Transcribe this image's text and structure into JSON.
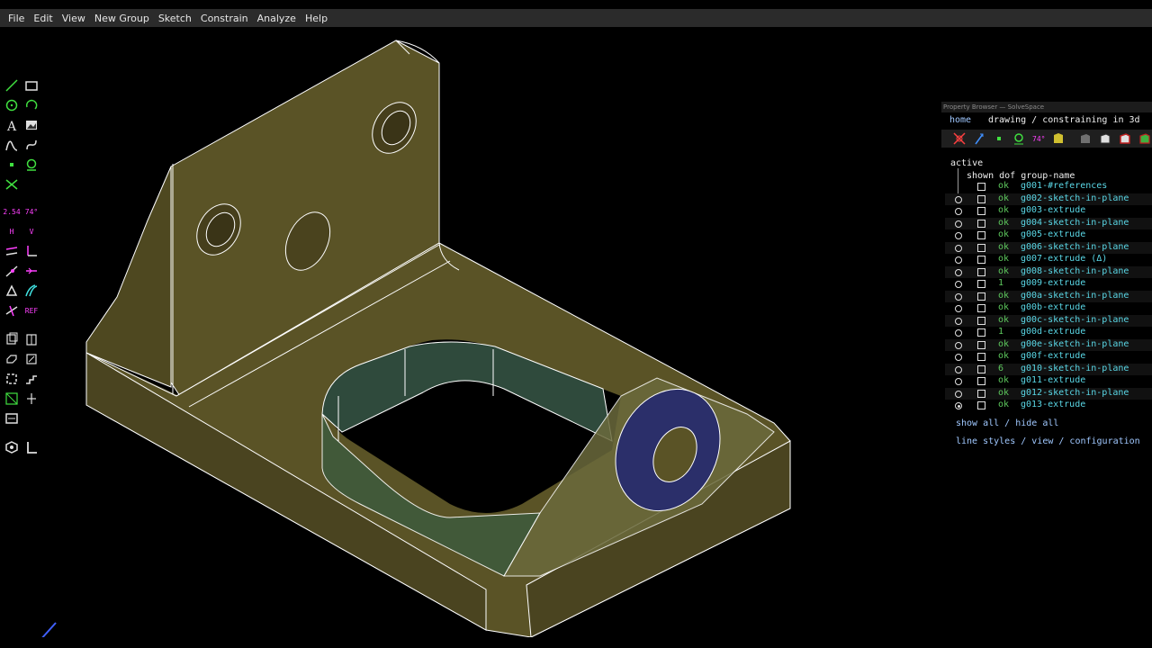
{
  "menu": [
    "File",
    "Edit",
    "View",
    "New Group",
    "Sketch",
    "Constrain",
    "Analyze",
    "Help"
  ],
  "toolbar": {
    "tools": [
      {
        "name": "line-tool-icon"
      },
      {
        "name": "rectangle-tool-icon"
      },
      {
        "name": "circle-tool-icon"
      },
      {
        "name": "arc-tool-icon"
      },
      {
        "name": "text-tool-icon"
      },
      {
        "name": "image-tool-icon"
      },
      {
        "name": "tangent-arc-tool-icon"
      },
      {
        "name": "bezier-tool-icon"
      },
      {
        "name": "point-tool-icon"
      },
      {
        "name": "workplane-tool-icon"
      },
      {
        "name": "split-curves-icon"
      },
      {
        "name": "distance-constraint-icon",
        "label": "2.54"
      },
      {
        "name": "angle-constraint-icon",
        "label": "74°"
      },
      {
        "name": "horizontal-constraint-icon",
        "label": "H"
      },
      {
        "name": "vertical-constraint-icon",
        "label": "V"
      },
      {
        "name": "parallel-constraint-icon"
      },
      {
        "name": "perpendicular-constraint-icon"
      },
      {
        "name": "on-entity-constraint-icon"
      },
      {
        "name": "symmetric-constraint-icon"
      },
      {
        "name": "equal-constraint-icon"
      },
      {
        "name": "tangent-constraint-icon"
      },
      {
        "name": "nearest-ortho-icon"
      },
      {
        "name": "reference-toggle-icon",
        "label": "REF"
      },
      {
        "name": "extrude-group-icon"
      },
      {
        "name": "lathe-group-icon"
      },
      {
        "name": "revolve-group-icon"
      },
      {
        "name": "helix-group-icon"
      },
      {
        "name": "step-rotate-icon"
      },
      {
        "name": "step-translate-icon"
      },
      {
        "name": "in-workplane-icon"
      },
      {
        "name": "in-3d-icon"
      },
      {
        "name": "link-file-icon"
      },
      {
        "name": "nearest-iso-icon"
      },
      {
        "name": "sketch-in-plane-icon"
      }
    ]
  },
  "property_browser": {
    "title": "Property Browser — SolveSpace",
    "home_link": "home",
    "mode": "drawing / constraining in 3d",
    "active_label": "active",
    "columns_header": "shown dof group-name",
    "groups": [
      {
        "radio": false,
        "dof": "ok",
        "name": "g001-#references"
      },
      {
        "radio": true,
        "dof": "ok",
        "name": "g002-sketch-in-plane"
      },
      {
        "radio": true,
        "dof": "ok",
        "name": "g003-extrude"
      },
      {
        "radio": true,
        "dof": "ok",
        "name": "g004-sketch-in-plane"
      },
      {
        "radio": true,
        "dof": "ok",
        "name": "g005-extrude"
      },
      {
        "radio": true,
        "dof": "ok",
        "name": "g006-sketch-in-plane"
      },
      {
        "radio": true,
        "dof": "ok",
        "name": "g007-extrude (Δ)"
      },
      {
        "radio": true,
        "dof": "ok",
        "name": "g008-sketch-in-plane"
      },
      {
        "radio": true,
        "dof": "1",
        "name": "g009-extrude"
      },
      {
        "radio": true,
        "dof": "ok",
        "name": "g00a-sketch-in-plane"
      },
      {
        "radio": true,
        "dof": "ok",
        "name": "g00b-extrude"
      },
      {
        "radio": true,
        "dof": "ok",
        "name": "g00c-sketch-in-plane"
      },
      {
        "radio": true,
        "dof": "1",
        "name": "g00d-extrude"
      },
      {
        "radio": true,
        "dof": "ok",
        "name": "g00e-sketch-in-plane"
      },
      {
        "radio": true,
        "dof": "ok",
        "name": "g00f-extrude"
      },
      {
        "radio": true,
        "dof": "6",
        "name": "g010-sketch-in-plane"
      },
      {
        "radio": true,
        "dof": "ok",
        "name": "g011-extrude"
      },
      {
        "radio": true,
        "dof": "ok",
        "name": "g012-sketch-in-plane"
      },
      {
        "radio": true,
        "dof": "ok",
        "name": "g013-extrude",
        "active": true
      }
    ],
    "show_all": "show all / hide all",
    "footer_links": "line styles / view / configuration"
  },
  "colors": {
    "menubar_bg": "#2b2b2b",
    "model_fill": "#5a5326",
    "model_edge": "#ffffff",
    "link": "#a0c8ff",
    "group_name": "#5ad7e6",
    "dof_ok": "#5ec95e",
    "constraint_magenta": "#ff40ff"
  }
}
